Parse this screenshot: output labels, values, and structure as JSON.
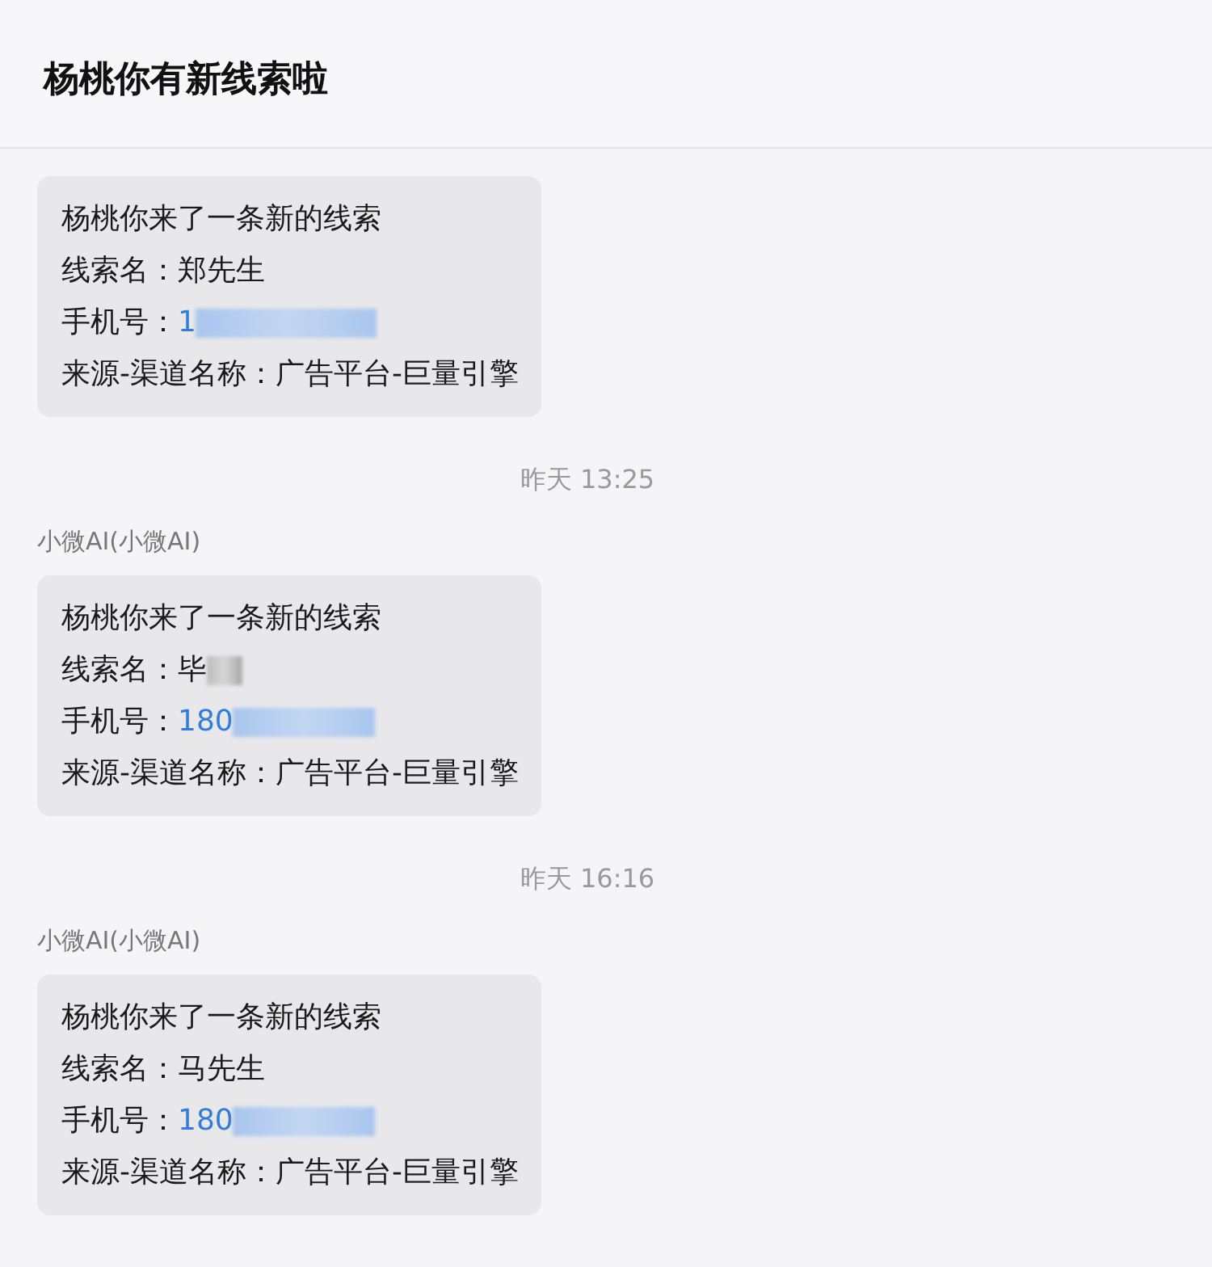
{
  "header": {
    "title": "杨桃你有新线索啦"
  },
  "messages": [
    {
      "kind": "message",
      "lines": [
        {
          "label": "杨桃你来了一条新的线索"
        },
        {
          "label": "线索名：",
          "value": "郑先生",
          "redacted": false,
          "link": false
        },
        {
          "label": "手机号：",
          "value": "1",
          "redacted": true,
          "link": true
        },
        {
          "label": "来源-渠道名称：",
          "value": "广告平台-巨量引擎",
          "redacted": false,
          "link": false
        }
      ]
    },
    {
      "kind": "time",
      "text": "昨天 13:25"
    },
    {
      "kind": "message",
      "sender": "小微AI(小微AI)",
      "lines": [
        {
          "label": "杨桃你来了一条新的线索"
        },
        {
          "label": "线索名：",
          "value": "毕",
          "redacted": true,
          "link": false
        },
        {
          "label": "手机号：",
          "value": "180",
          "redacted": true,
          "link": true
        },
        {
          "label": "来源-渠道名称：",
          "value": "广告平台-巨量引擎",
          "redacted": false,
          "link": false
        }
      ]
    },
    {
      "kind": "time",
      "text": "昨天 16:16"
    },
    {
      "kind": "message",
      "sender": "小微AI(小微AI)",
      "lines": [
        {
          "label": "杨桃你来了一条新的线索"
        },
        {
          "label": "线索名：",
          "value": "马先生",
          "redacted": false,
          "link": false
        },
        {
          "label": "手机号：",
          "value": "180",
          "redacted": true,
          "link": true
        },
        {
          "label": "来源-渠道名称：",
          "value": "广告平台-巨量引擎",
          "redacted": false,
          "link": false
        }
      ]
    }
  ]
}
